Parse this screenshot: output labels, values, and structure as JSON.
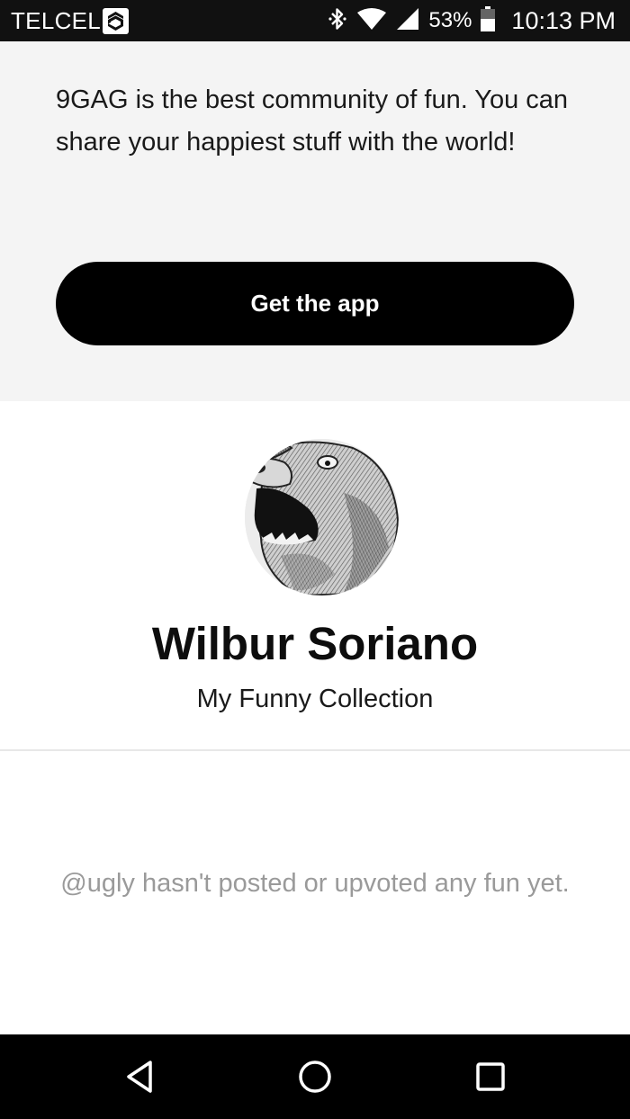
{
  "status_bar": {
    "carrier": "TELCEL",
    "battery_percent": "53%",
    "time": "10:13 PM",
    "icons": [
      "carrier-logo-icon",
      "bluetooth-icon",
      "wifi-icon",
      "signal-icon",
      "battery-icon"
    ]
  },
  "promo": {
    "text": "9GAG is the best community of fun. You can share your happiest stuff with the world!",
    "button_label": "Get the app"
  },
  "profile": {
    "name": "Wilbur Soriano",
    "subtitle": "My Funny Collection",
    "avatar": "bear-illustration-avatar"
  },
  "feed": {
    "empty_message": "@ugly hasn't posted or upvoted any fun yet."
  },
  "nav": {
    "icons": [
      "back-icon",
      "home-icon",
      "recents-icon"
    ]
  },
  "colors": {
    "promo_background": "#f4f4f4",
    "button_background": "#000000",
    "empty_text": "#9a9a9a"
  }
}
